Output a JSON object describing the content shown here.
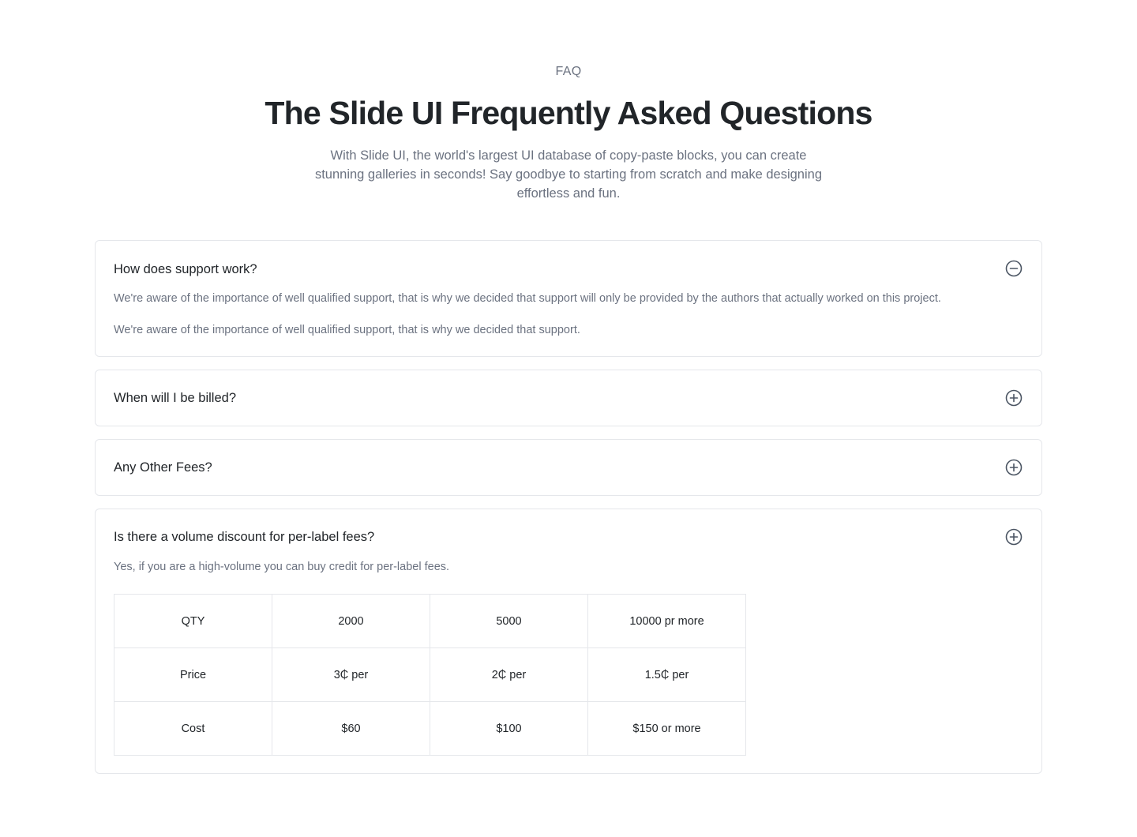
{
  "header": {
    "eyebrow": "FAQ",
    "title": "The Slide UI Frequently Asked Questions",
    "subtitle": "With Slide UI, the world's largest UI database of copy-paste blocks, you can create stunning galleries in seconds! Say goodbye to starting from scratch and make designing effortless and fun."
  },
  "faq": {
    "items": [
      {
        "question": "How does support work?",
        "state": "expanded",
        "toggle_icon": "minus-circle-icon",
        "answers": [
          "We're aware of the importance of well qualified support, that is why we decided that support will only be provided by the authors that actually worked on this project.",
          "We're aware of the importance of well qualified support, that is why we decided that support."
        ]
      },
      {
        "question": "When will I be billed?",
        "state": "collapsed",
        "toggle_icon": "plus-circle-icon"
      },
      {
        "question": "Any Other Fees?",
        "state": "collapsed",
        "toggle_icon": "plus-circle-icon"
      },
      {
        "question": "Is there a volume discount for per-label fees?",
        "state": "expanded",
        "toggle_icon": "plus-circle-icon",
        "answers": [
          "Yes, if you are a high-volume you can buy credit for per-label fees."
        ],
        "table": {
          "rows": [
            [
              "QTY",
              "2000",
              "5000",
              "10000 pr more"
            ],
            [
              "Price",
              "3₵ per",
              "2₵ per",
              "1.5₵ per"
            ],
            [
              "Cost",
              "$60",
              "$100",
              "$150 or more"
            ]
          ]
        }
      }
    ]
  },
  "colors": {
    "text_primary": "#212529",
    "text_muted": "#6b7280",
    "border": "#e5e7eb",
    "icon": "#4b5563"
  }
}
